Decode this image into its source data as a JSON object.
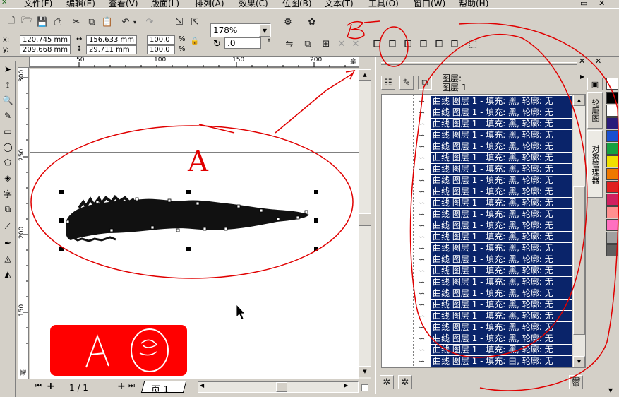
{
  "menubar": {
    "items": [
      "文件(F)",
      "编辑(E)",
      "查看(V)",
      "版面(L)",
      "排列(A)",
      "效果(C)",
      "位图(B)",
      "文本(T)",
      "工具(O)",
      "窗口(W)",
      "帮助(H)"
    ]
  },
  "toolbar": {
    "zoom_value": "178%"
  },
  "property_bar": {
    "x_label": "x:",
    "y_label": "y:",
    "x_value": "120.745 mm",
    "y_value": "209.668 mm",
    "width_value": "156.633 mm",
    "height_value": "29.711 mm",
    "scale_x": "100.0",
    "scale_y": "100.0",
    "percent_symbol": "%",
    "rotation_value": ".0",
    "degree_symbol": "°"
  },
  "ruler": {
    "top_ticks": [
      "50",
      "100",
      "150",
      "200"
    ],
    "left_ticks": [
      "300",
      "250",
      "200",
      "150"
    ],
    "unit": "毫米",
    "unit_left": "毫米"
  },
  "page_nav": {
    "page_indicator": "1 / 1",
    "page_tab": "页 1"
  },
  "object_manager": {
    "layer_label": "图层:",
    "layer_name": "图层 1",
    "rows": [
      "曲线 图层 1 - 填充: 黑, 轮廓: 无",
      "曲线 图层 1 - 填充: 黑, 轮廓: 无",
      "曲线 图层 1 - 填充: 黑, 轮廓: 无",
      "曲线 图层 1 - 填充: 黑, 轮廓: 无",
      "曲线 图层 1 - 填充: 黑, 轮廓: 无",
      "曲线 图层 1 - 填充: 黑, 轮廓: 无",
      "曲线 图层 1 - 填充: 黑, 轮廓: 无",
      "曲线 图层 1 - 填充: 黑, 轮廓: 无",
      "曲线 图层 1 - 填充: 黑, 轮廓: 无",
      "曲线 图层 1 - 填充: 黑, 轮廓: 无",
      "曲线 图层 1 - 填充: 黑, 轮廓: 无",
      "曲线 图层 1 - 填充: 黑, 轮廓: 无",
      "曲线 图层 1 - 填充: 黑, 轮廓: 无",
      "曲线 图层 1 - 填充: 黑, 轮廓: 无",
      "曲线 图层 1 - 填充: 黑, 轮廓: 无",
      "曲线 图层 1 - 填充: 黑, 轮廓: 无",
      "曲线 图层 1 - 填充: 黑, 轮廓: 无",
      "曲线 图层 1 - 填充: 黑, 轮廓: 无",
      "曲线 图层 1 - 填充: 黑, 轮廓: 无",
      "曲线 图层 1 - 填充: 黑, 轮廓: 无",
      "曲线 图层 1 - 填充: 黑, 轮廓: 无",
      "曲线 图层 1 - 填充: 黑, 轮廓: 无",
      "曲线 图层 1 - 填充: 黑, 轮廓: 无",
      "曲线 图层 1 - 填充: 白, 轮廓: 无"
    ]
  },
  "docker_tabs": {
    "outline_tab": "轮廓图",
    "object_manager_tab": "对象管理器"
  },
  "annotations": {
    "label_a": "A",
    "label_b": "B",
    "badge_text_a": "A"
  },
  "colors": {
    "selection_blue": "#0a246a",
    "annotation_red": "#e00000",
    "badge_red": "#ff0000"
  },
  "palette_colors": [
    "#000000",
    "#ffffff",
    "#2a1a7a",
    "#1a4fd0",
    "#16a040",
    "#f0e000",
    "#f07800",
    "#e02020",
    "#d02060",
    "#ff9090",
    "#ff70c0",
    "#a0a0a0",
    "#606060"
  ]
}
